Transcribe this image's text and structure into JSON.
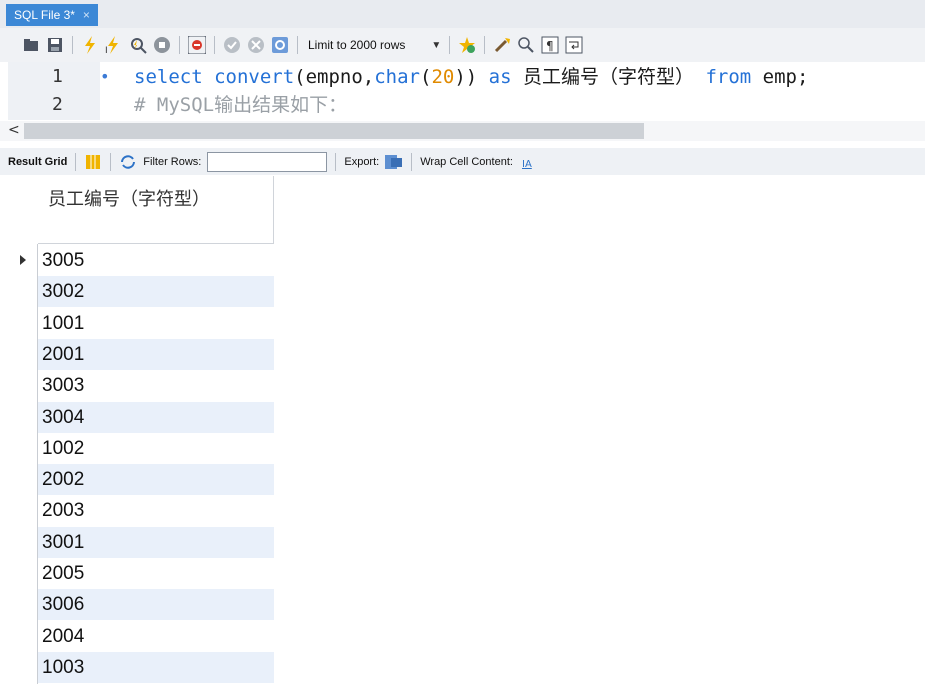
{
  "tab": {
    "title": "SQL File 3*",
    "close": "×"
  },
  "toolbar": {
    "limit_label": "Limit to 2000 rows",
    "icons": [
      "open-folder-icon",
      "save-icon",
      "execute-icon",
      "execute-current-icon",
      "explain-icon",
      "stop-icon",
      "toggle-output-icon",
      "commit-icon",
      "rollback-icon",
      "autocommit-icon",
      "add-snippet-icon",
      "beautify-icon",
      "find-icon",
      "invisible-chars-icon",
      "word-wrap-icon"
    ]
  },
  "editor": {
    "lines": [
      {
        "num": "1",
        "marker": "•",
        "parts": [
          {
            "cls": "kw",
            "t": "select "
          },
          {
            "cls": "kw",
            "t": "convert"
          },
          {
            "cls": "plain",
            "t": "(empno,"
          },
          {
            "cls": "kw",
            "t": "char"
          },
          {
            "cls": "plain",
            "t": "("
          },
          {
            "cls": "num",
            "t": "20"
          },
          {
            "cls": "plain",
            "t": ")) "
          },
          {
            "cls": "kw",
            "t": "as "
          },
          {
            "cls": "plain",
            "t": "员工编号（字符型） "
          },
          {
            "cls": "kw",
            "t": "from "
          },
          {
            "cls": "plain",
            "t": "emp;"
          }
        ]
      },
      {
        "num": "2",
        "marker": "",
        "parts": [
          {
            "cls": "comment",
            "t": "# MySQL输出结果如下："
          }
        ]
      }
    ]
  },
  "scrollbar": {
    "left_arrow": "<"
  },
  "result_bar": {
    "result_grid": "Result Grid",
    "filter_rows": "Filter Rows:",
    "filter_value": "",
    "export": "Export:",
    "wrap": "Wrap Cell Content:"
  },
  "grid": {
    "column_header": "员工编号（字符型）",
    "rows": [
      "3005",
      "3002",
      "1001",
      "2001",
      "3003",
      "3004",
      "1002",
      "2002",
      "2003",
      "3001",
      "2005",
      "3006",
      "2004",
      "1003"
    ]
  },
  "colors": {
    "tab_blue": "#3c88d6",
    "keyword": "#2471d6",
    "number": "#e08a00",
    "alt_row": "#e9f0fa"
  }
}
